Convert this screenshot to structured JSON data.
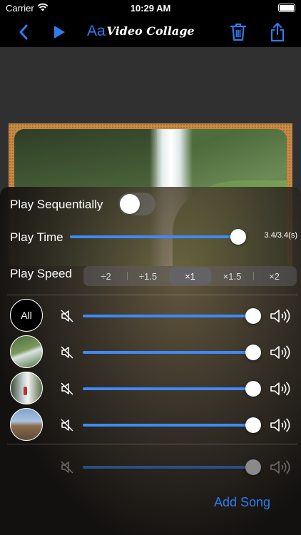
{
  "status_bar": {
    "carrier": "Carrier",
    "time": "10:29 AM"
  },
  "nav": {
    "title": "Video Collage",
    "font_button": "Aa"
  },
  "colors": {
    "accent": "#2f7bf0",
    "slider": "#3f89f6"
  },
  "controls": {
    "play_sequentially": {
      "label": "Play Sequentially",
      "on": false
    },
    "play_time": {
      "label": "Play Time",
      "value_text": "3.4/3.4(s)",
      "fraction": 1.0
    },
    "play_speed": {
      "label": "Play Speed",
      "options": [
        "÷2",
        "÷1.5",
        "×1",
        "×1.5",
        "×2"
      ],
      "selected": "×1"
    }
  },
  "tracks": [
    {
      "avatar_label": "All",
      "volume": 1.0
    },
    {
      "avatar_label": "",
      "volume": 1.0
    },
    {
      "avatar_label": "",
      "volume": 1.0
    },
    {
      "avatar_label": "",
      "volume": 1.0
    }
  ],
  "song_track": {
    "volume": 1.0,
    "enabled": false
  },
  "add_song_label": "Add Song"
}
